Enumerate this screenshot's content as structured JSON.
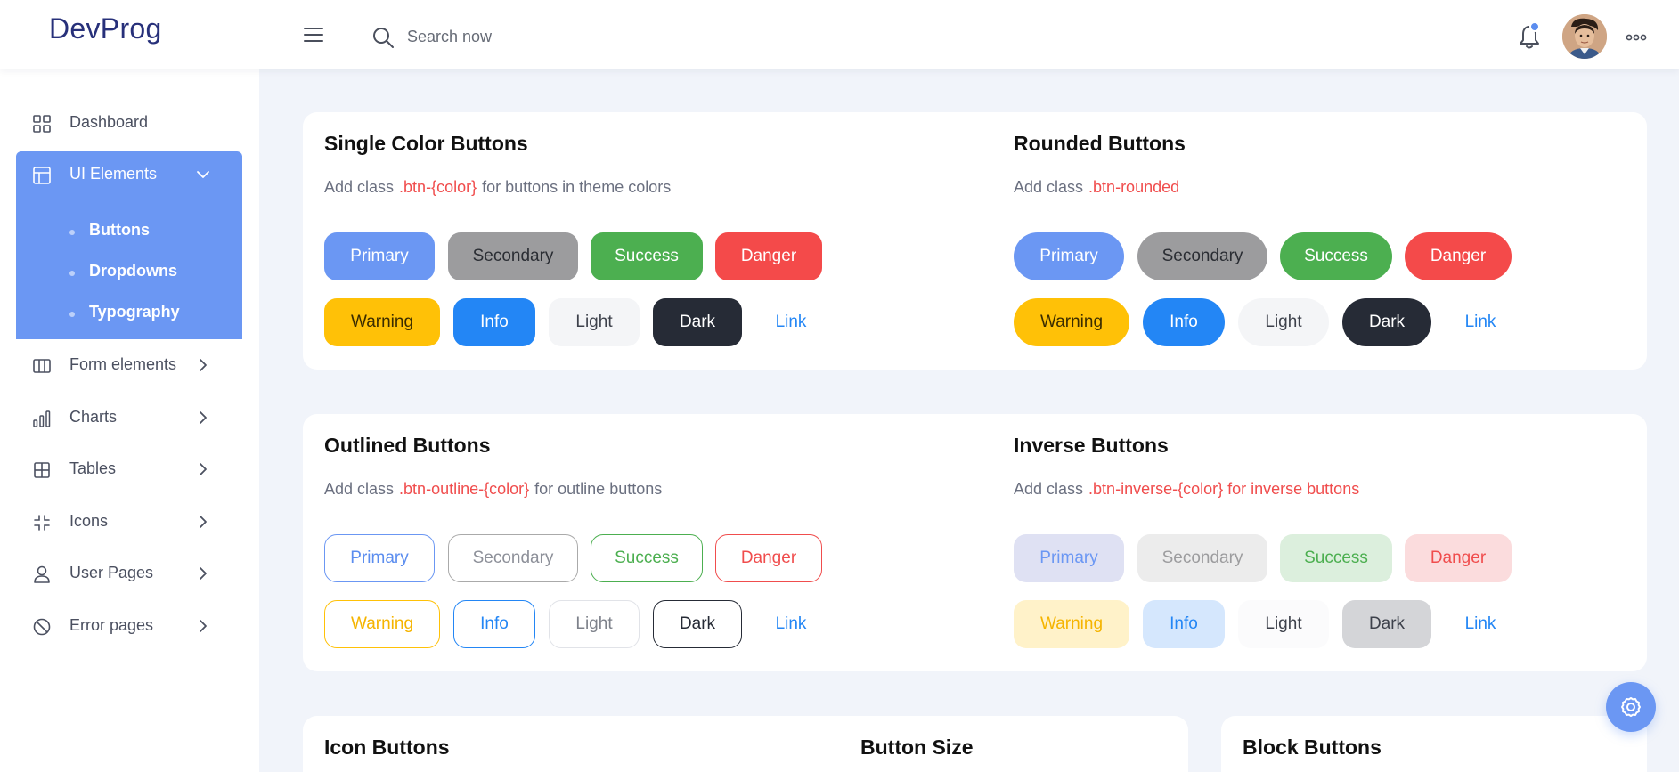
{
  "app": {
    "brand": "DevProg"
  },
  "header": {
    "search": {
      "placeholder": "Search now",
      "value": ""
    },
    "notification_dot_color": "#5b8def"
  },
  "sidebar": {
    "items": [
      {
        "label": "Dashboard",
        "icon": "grid-icon"
      },
      {
        "label": "UI Elements",
        "icon": "layout-icon",
        "active": true,
        "subitems": [
          "Buttons",
          "Dropdowns",
          "Typography"
        ]
      },
      {
        "label": "Form elements",
        "icon": "columns-icon"
      },
      {
        "label": "Charts",
        "icon": "bar-chart-icon"
      },
      {
        "label": "Tables",
        "icon": "table-icon"
      },
      {
        "label": "Icons",
        "icon": "shrink-icon"
      },
      {
        "label": "User Pages",
        "icon": "user-icon"
      },
      {
        "label": "Error pages",
        "icon": "ban-icon"
      }
    ]
  },
  "sections": {
    "single": {
      "title": "Single Color Buttons",
      "desc_pre": "Add class",
      "desc_code": ".btn-{color}",
      "desc_post": "for buttons in theme colors"
    },
    "rounded": {
      "title": "Rounded Buttons",
      "desc_pre": "Add class",
      "desc_code": ".btn-rounded"
    },
    "outlined": {
      "title": "Outlined Buttons",
      "desc_pre": "Add class",
      "desc_code": ".btn-outline-{color}",
      "desc_post": "for outline buttons"
    },
    "inverse": {
      "title": "Inverse Buttons",
      "desc_pre": "Add class",
      "desc_code": ".btn-inverse-{color} for inverse buttons"
    },
    "icon": {
      "title": "Icon Buttons"
    },
    "size": {
      "title": "Button Size"
    },
    "block": {
      "title": "Block Buttons"
    }
  },
  "buttons": {
    "primary": "Primary",
    "secondary": "Secondary",
    "success": "Success",
    "danger": "Danger",
    "warning": "Warning",
    "info": "Info",
    "light": "Light",
    "dark": "Dark",
    "link": "Link"
  },
  "colors": {
    "accent": "#6b97f3",
    "primary": "#6b97f3",
    "secondary": "#9c9c9e",
    "success": "#4caf50",
    "danger": "#f44a4a",
    "warning": "#ffc107",
    "info": "#2386f5",
    "dark": "#262b36",
    "code": "#f04d4d"
  }
}
